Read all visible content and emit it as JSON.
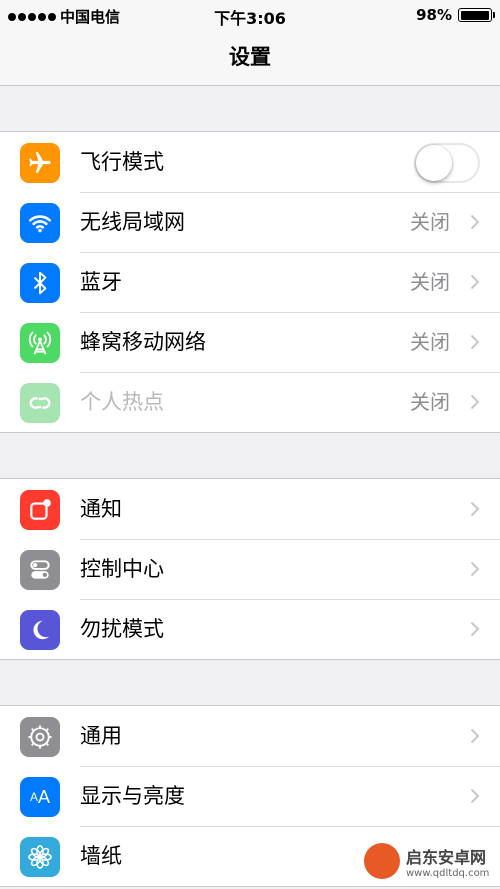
{
  "status_bar": {
    "carrier": "中国电信",
    "time": "下午3:06",
    "battery_percent": "98%",
    "battery_level": 0.98
  },
  "nav": {
    "title": "设置"
  },
  "groups": [
    {
      "items": [
        {
          "label": "飞行模式",
          "icon": "airplane-icon",
          "icon_color": "#ff9500",
          "control": "toggle",
          "toggle_on": false
        },
        {
          "label": "无线局域网",
          "icon": "wifi-icon",
          "icon_color": "#007aff",
          "value": "关闭"
        },
        {
          "label": "蓝牙",
          "icon": "bluetooth-icon",
          "icon_color": "#007aff",
          "value": "关闭"
        },
        {
          "label": "蜂窝移动网络",
          "icon": "cellular-icon",
          "icon_color": "#4cd964",
          "value": "关闭"
        },
        {
          "label": "个人热点",
          "icon": "hotspot-icon",
          "icon_color": "#a6e4b1",
          "value": "关闭",
          "disabled": true
        }
      ]
    },
    {
      "items": [
        {
          "label": "通知",
          "icon": "notifications-icon",
          "icon_color": "#ff3b30"
        },
        {
          "label": "控制中心",
          "icon": "control-center-icon",
          "icon_color": "#8e8e93"
        },
        {
          "label": "勿扰模式",
          "icon": "moon-icon",
          "icon_color": "#5856d6"
        }
      ]
    },
    {
      "items": [
        {
          "label": "通用",
          "icon": "gear-icon",
          "icon_color": "#8e8e93"
        },
        {
          "label": "显示与亮度",
          "icon": "display-brightness-icon",
          "icon_color": "#007aff"
        },
        {
          "label": "墙纸",
          "icon": "wallpaper-flower-icon",
          "icon_color": "#34aadc"
        }
      ]
    }
  ],
  "watermark": {
    "name": "启东安卓网",
    "url": "www.qdltdq.com"
  }
}
